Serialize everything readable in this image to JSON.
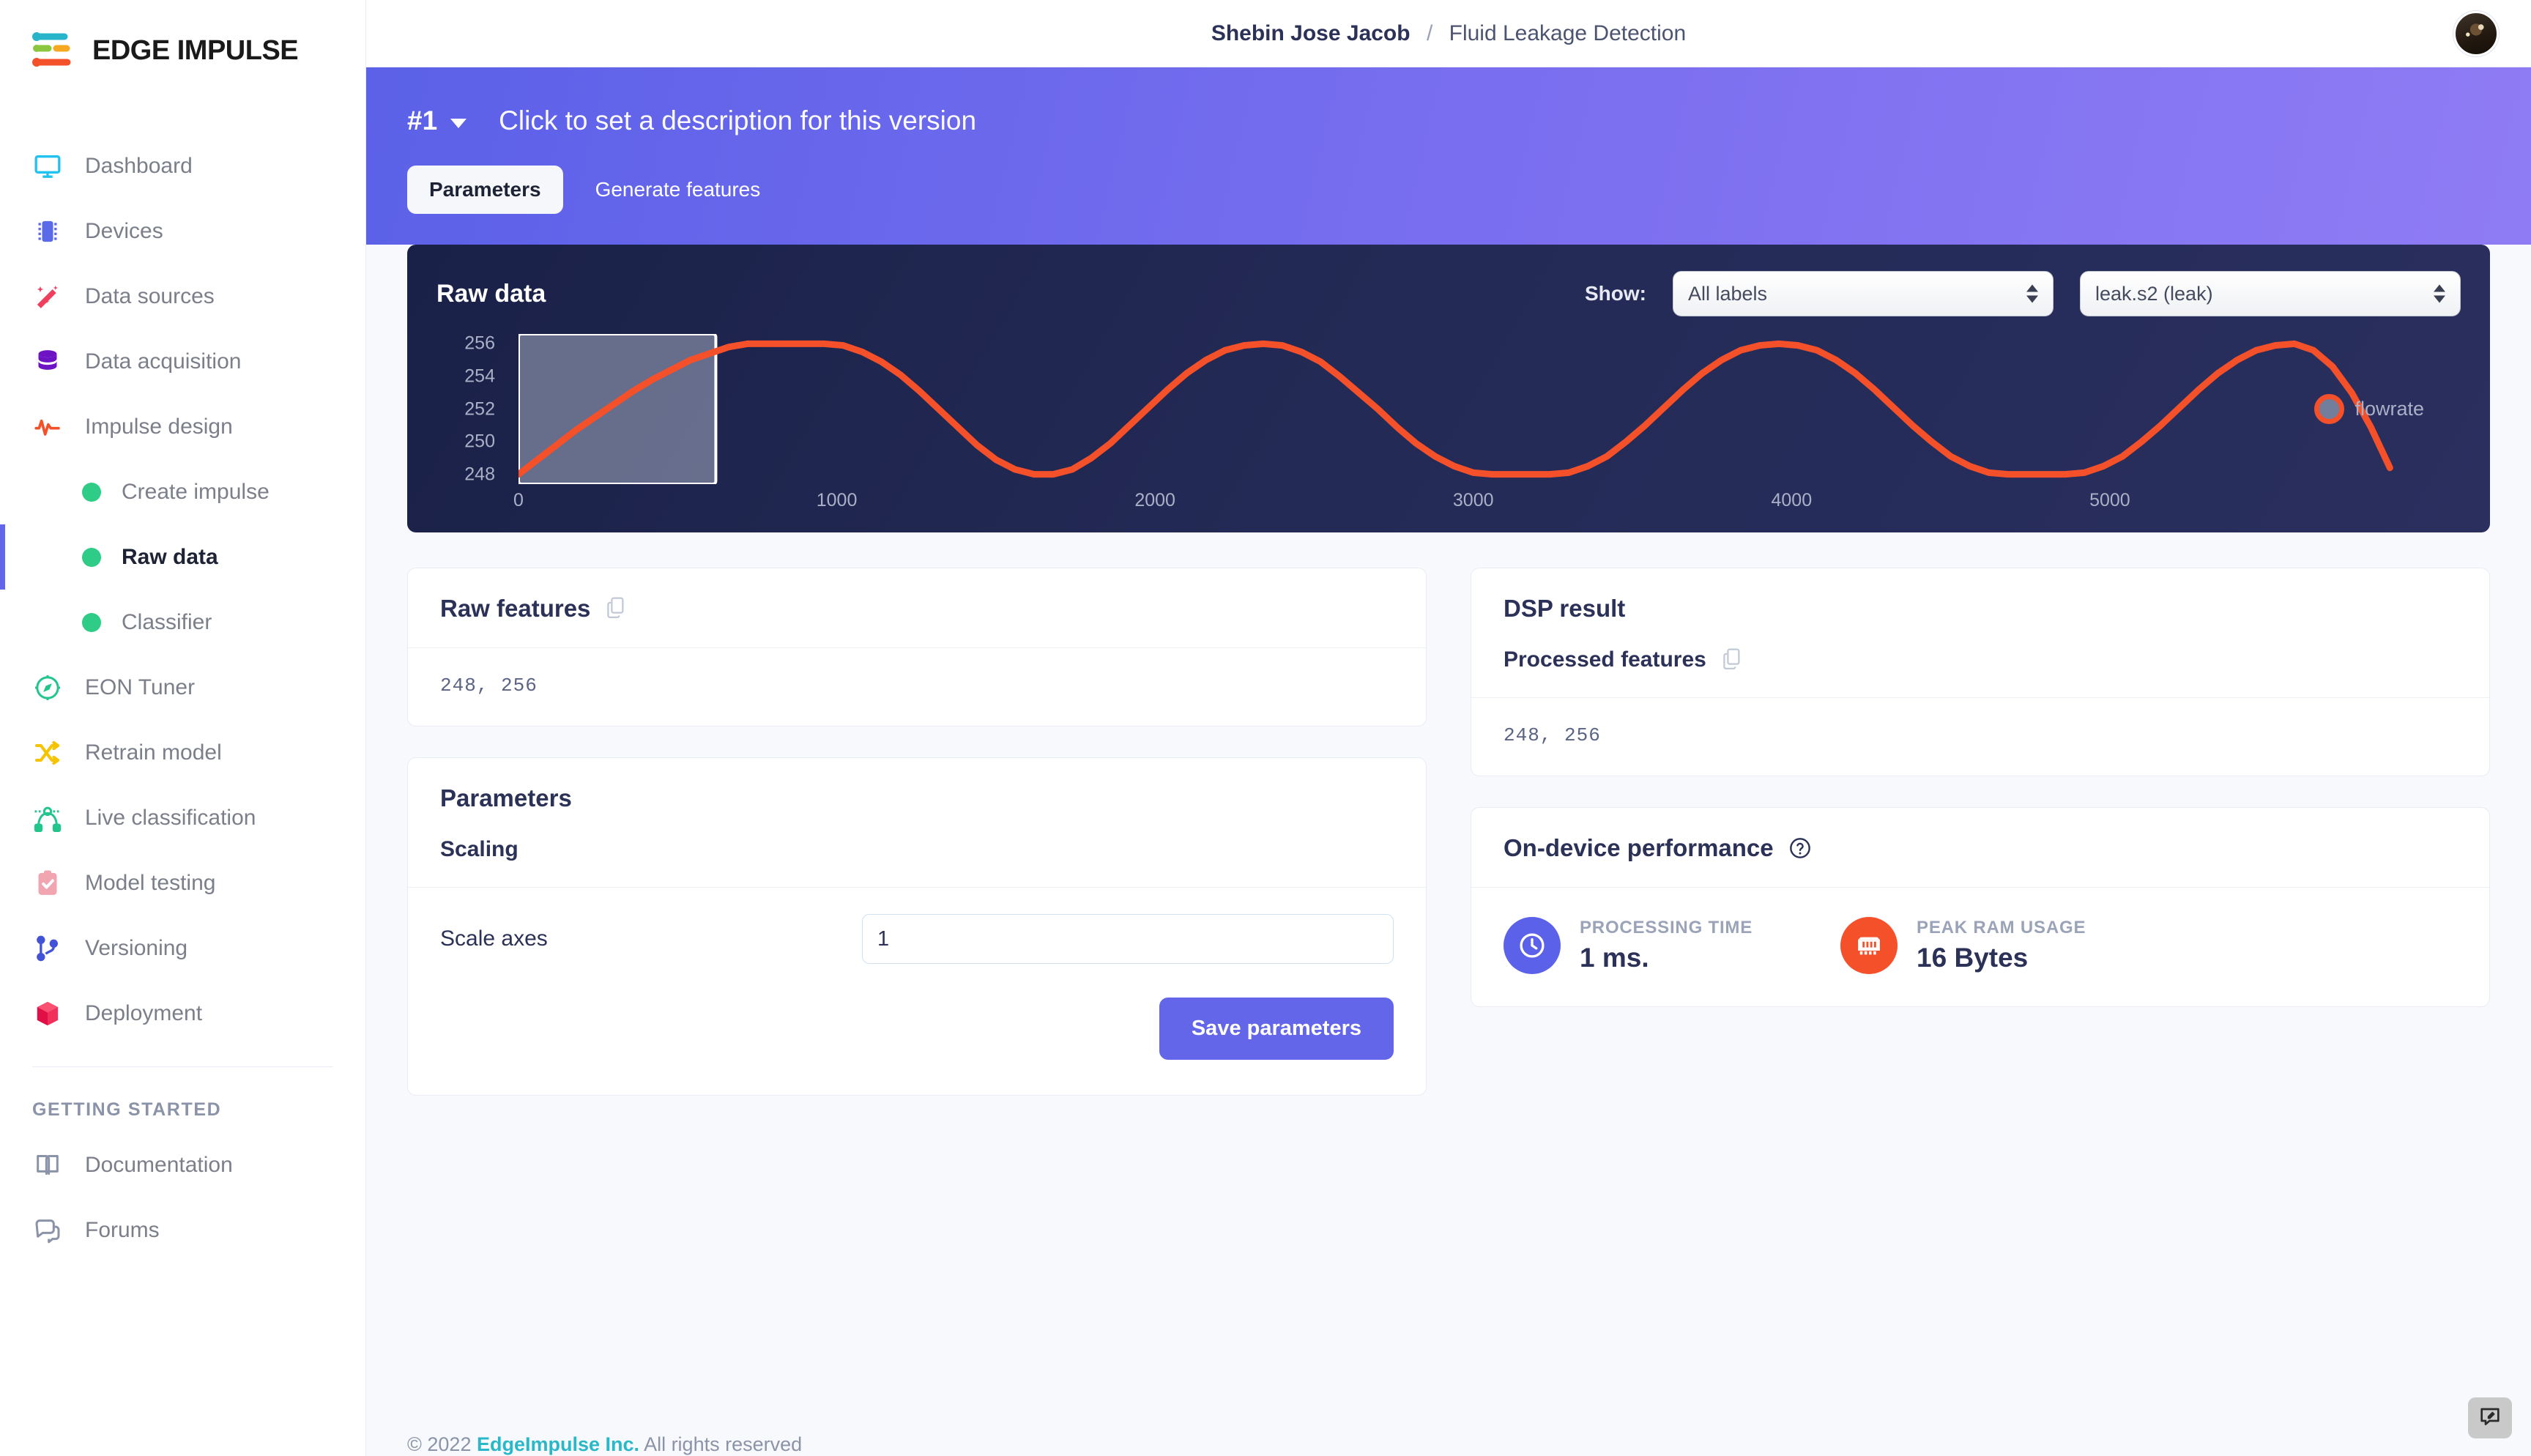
{
  "brand": {
    "name": "EDGE IMPULSE"
  },
  "header": {
    "breadcrumb_owner": "Shebin Jose Jacob",
    "breadcrumb_separator": "/",
    "breadcrumb_project": "Fluid Leakage Detection",
    "avatar_name": "user-avatar"
  },
  "sidebar": {
    "items": [
      {
        "label": "Dashboard",
        "icon": "monitor-icon"
      },
      {
        "label": "Devices",
        "icon": "chip-icon"
      },
      {
        "label": "Data sources",
        "icon": "magic-wand-icon"
      },
      {
        "label": "Data acquisition",
        "icon": "database-icon"
      },
      {
        "label": "Impulse design",
        "icon": "pulse-icon"
      }
    ],
    "subitems": [
      {
        "label": "Create impulse",
        "active": false
      },
      {
        "label": "Raw data",
        "active": true
      },
      {
        "label": "Classifier",
        "active": false
      }
    ],
    "items2": [
      {
        "label": "EON Tuner",
        "icon": "compass-icon"
      },
      {
        "label": "Retrain model",
        "icon": "shuffle-icon"
      },
      {
        "label": "Live classification",
        "icon": "nodes-icon"
      },
      {
        "label": "Model testing",
        "icon": "clipboard-check-icon"
      },
      {
        "label": "Versioning",
        "icon": "git-branch-icon"
      },
      {
        "label": "Deployment",
        "icon": "box-icon"
      }
    ],
    "section_title": "GETTING STARTED",
    "items3": [
      {
        "label": "Documentation",
        "icon": "book-icon"
      },
      {
        "label": "Forums",
        "icon": "chat-icon"
      }
    ]
  },
  "banner": {
    "version": "#1",
    "description": "Click to set a description for this version",
    "tabs": [
      {
        "label": "Parameters",
        "active": true
      },
      {
        "label": "Generate features",
        "active": false
      }
    ]
  },
  "raw_data_panel": {
    "title": "Raw data",
    "show_label": "Show:",
    "labels_select_value": "All labels",
    "sample_select_value": "leak.s2 (leak)"
  },
  "chart_data": {
    "type": "line",
    "title": "Raw data",
    "xlabel": "",
    "ylabel": "",
    "xlim": [
      0,
      5900
    ],
    "ylim": [
      247.4,
      256.6
    ],
    "xticks": [
      0,
      1000,
      2000,
      3000,
      4000,
      5000
    ],
    "yticks": [
      248,
      250,
      252,
      254,
      256
    ],
    "grid": false,
    "legend_position": "right",
    "series": [
      {
        "name": "flowrate",
        "color": "#f4502a",
        "x": [
          0,
          60,
          120,
          180,
          240,
          300,
          360,
          420,
          480,
          540,
          600,
          660,
          720,
          780,
          840,
          900,
          960,
          1020,
          1080,
          1140,
          1200,
          1260,
          1320,
          1380,
          1440,
          1500,
          1560,
          1620,
          1680,
          1740,
          1800,
          1860,
          1920,
          1980,
          2040,
          2100,
          2160,
          2220,
          2280,
          2340,
          2400,
          2460,
          2520,
          2580,
          2640,
          2700,
          2760,
          2820,
          2880,
          2940,
          3000,
          3060,
          3120,
          3180,
          3240,
          3300,
          3360,
          3420,
          3480,
          3540,
          3600,
          3660,
          3720,
          3780,
          3840,
          3900,
          3960,
          4020,
          4080,
          4140,
          4200,
          4260,
          4320,
          4380,
          4440,
          4500,
          4560,
          4620,
          4680,
          4740,
          4800,
          4860,
          4920,
          4980,
          5040,
          5100,
          5160,
          5220,
          5280,
          5340,
          5400,
          5460,
          5520,
          5580,
          5640,
          5700,
          5760,
          5820,
          5880
        ],
        "y": [
          248.0,
          248.9,
          249.8,
          250.7,
          251.5,
          252.3,
          253.1,
          253.8,
          254.4,
          255.0,
          255.4,
          255.8,
          256.0,
          256.0,
          256.0,
          256.0,
          256.0,
          255.9,
          255.5,
          254.9,
          254.1,
          253.1,
          252.0,
          250.9,
          249.8,
          248.9,
          248.3,
          248.0,
          248.0,
          248.3,
          249.0,
          249.9,
          251.0,
          252.1,
          253.2,
          254.2,
          255.0,
          255.6,
          255.9,
          256.0,
          255.9,
          255.5,
          254.9,
          254.0,
          253.0,
          252.0,
          250.9,
          249.9,
          249.1,
          248.5,
          248.1,
          248.0,
          248.0,
          248.0,
          248.0,
          248.1,
          248.5,
          249.1,
          250.0,
          251.0,
          252.1,
          253.2,
          254.2,
          255.0,
          255.6,
          255.9,
          256.0,
          255.9,
          255.6,
          255.0,
          254.2,
          253.2,
          252.1,
          251.0,
          250.0,
          249.1,
          248.5,
          248.1,
          248.0,
          248.0,
          248.0,
          248.0,
          248.1,
          248.5,
          249.1,
          250.0,
          251.0,
          252.1,
          253.2,
          254.2,
          255.0,
          255.6,
          255.9,
          256.0,
          255.6,
          254.6,
          253.0,
          250.9,
          248.4
        ]
      }
    ],
    "selection_window": {
      "x_start": 0,
      "x_end": 620,
      "label": "selected-region"
    },
    "legend": [
      {
        "label": "flowrate",
        "color": "#f4502a"
      }
    ]
  },
  "raw_features": {
    "title": "Raw features",
    "copy_icon": "copy-icon",
    "values": "248,  256"
  },
  "parameters_card": {
    "title": "Parameters",
    "section_label": "Scaling",
    "scale_axes_label": "Scale axes",
    "scale_axes_value": "1",
    "save_button": "Save parameters"
  },
  "dsp_result": {
    "title": "DSP result",
    "processed_features_label": "Processed features",
    "copy_icon": "copy-icon",
    "values": "248,  256"
  },
  "performance": {
    "title": "On-device performance",
    "help_icon": "help-circle-icon",
    "metrics": [
      {
        "caption": "PROCESSING TIME",
        "value": "1 ms.",
        "icon": "clock-icon",
        "color": "#5b61e8"
      },
      {
        "caption": "PEAK RAM USAGE",
        "value": "16 Bytes",
        "icon": "ram-chip-icon",
        "color": "#f4502a"
      }
    ]
  },
  "footer": {
    "copyright": "© 2022",
    "company": "EdgeImpulse Inc.",
    "rights": "All rights reserved"
  },
  "chat_widget": {
    "icon": "feedback-pencil-icon"
  }
}
